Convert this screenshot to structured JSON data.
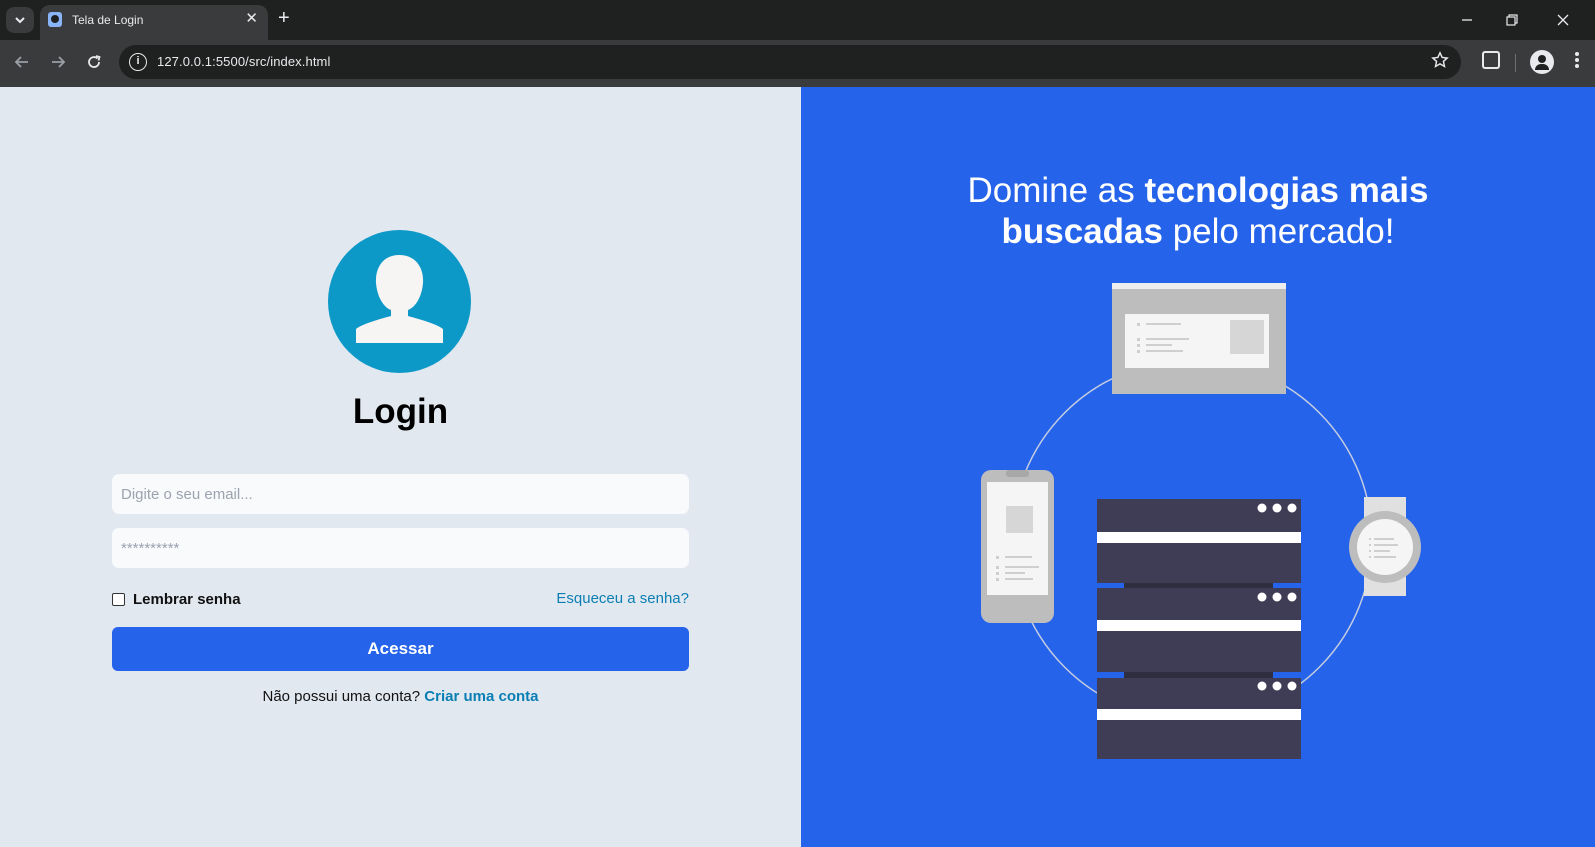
{
  "browser": {
    "tab_title": "Tela de Login",
    "new_tab_symbol": "+",
    "url": "127.0.0.1:5500/src/index.html",
    "close_symbol": "✕"
  },
  "login": {
    "title": "Login",
    "email_placeholder": "Digite o seu email...",
    "password_value": "**********",
    "remember_label": "Lembrar senha",
    "forgot_link": "Esqueceu a senha?",
    "submit_label": "Acessar",
    "signup_text": "Não possui uma conta?",
    "signup_link": "Criar uma conta",
    "avatar_color": "#0d99c8",
    "accent": "#2563eb"
  },
  "hero": {
    "headline_part1": "Domine as ",
    "headline_bold1": "tecnologias mais",
    "headline_bold2": "buscadas",
    "headline_part2": " pelo mercado!",
    "background": "#2563eb"
  },
  "icons": {
    "tab_search": "chevron-down-icon",
    "back": "arrow-left-icon",
    "forward": "arrow-right-icon",
    "reload": "reload-icon",
    "site_info": "info-icon",
    "bookmark": "star-icon",
    "extensions": "puzzle-icon",
    "profile": "profile-icon",
    "menu": "more-vert-icon"
  }
}
